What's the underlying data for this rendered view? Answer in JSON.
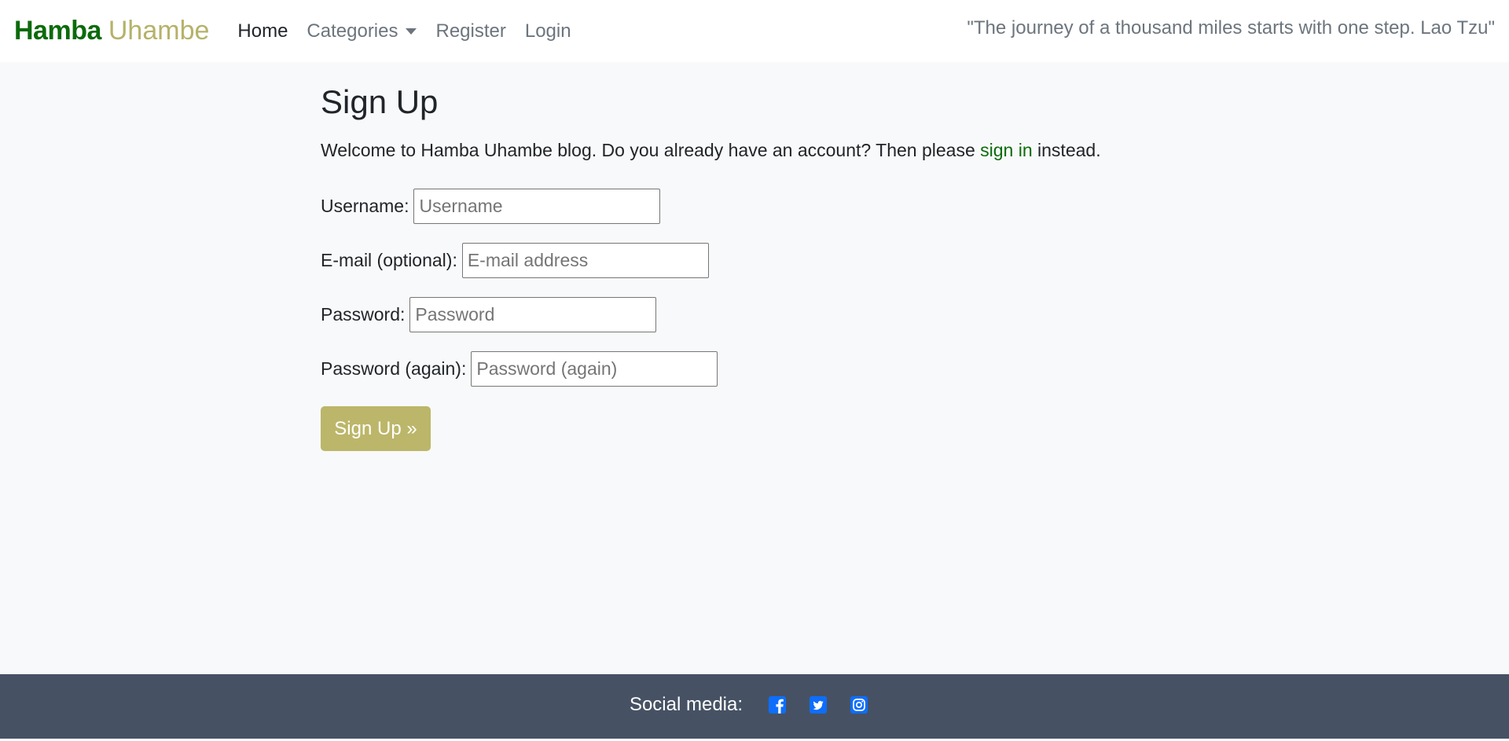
{
  "brand": {
    "main": "Hamba",
    "sub": "Uhambe"
  },
  "nav": {
    "home": "Home",
    "categories": "Categories",
    "register": "Register",
    "login": "Login"
  },
  "quote": "\"The journey of a thousand miles starts with one step. Lao Tzu\"",
  "page": {
    "title": "Sign Up",
    "intro_before": "Welcome to Hamba Uhambe blog. Do you already have an account? Then please ",
    "intro_link": "sign in",
    "intro_after": " instead."
  },
  "form": {
    "username": {
      "label": "Username:",
      "placeholder": "Username",
      "value": ""
    },
    "email": {
      "label": "E-mail (optional):",
      "placeholder": "E-mail address",
      "value": ""
    },
    "password": {
      "label": "Password:",
      "placeholder": "Password",
      "value": ""
    },
    "password2": {
      "label": "Password (again):",
      "placeholder": "Password (again)",
      "value": ""
    },
    "submit": "Sign Up »"
  },
  "footer": {
    "label": "Social media:",
    "icons": [
      "facebook-icon",
      "twitter-icon",
      "instagram-icon"
    ],
    "icon_color": "#0d6efd"
  },
  "colors": {
    "brand_green": "#0b6b0b",
    "brand_olive": "#b5b26a",
    "button": "#bcb66a",
    "footer_bg": "#465264",
    "page_bg": "#f8f9fa"
  }
}
